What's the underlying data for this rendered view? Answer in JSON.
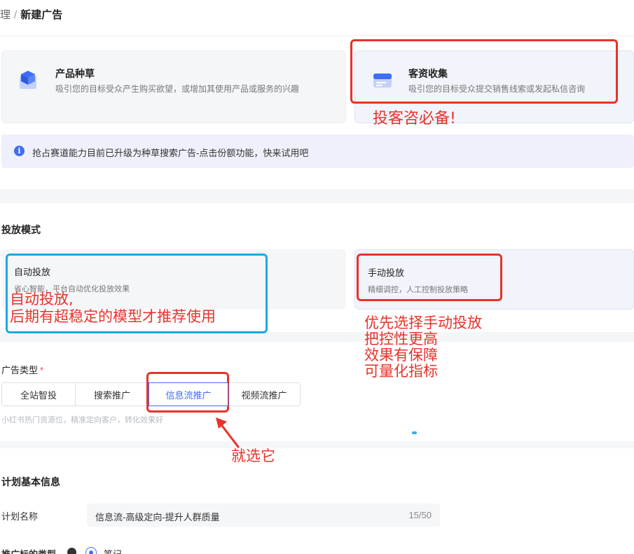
{
  "breadcrumb": {
    "prev": "理",
    "separator": "/",
    "current": "新建广告"
  },
  "goals": [
    {
      "title": "产品种草",
      "desc": "吸引您的目标受众产生购买欲望，或增加其使用产品或服务的兴趣",
      "icon": "cube-icon"
    },
    {
      "title": "客资收集",
      "desc": "吸引您的目标受众提交销售线索或发起私信咨询",
      "icon": "form-card-icon"
    }
  ],
  "notice": {
    "icon": "info-icon",
    "glyph": "i",
    "text": "抢占赛道能力目前已升级为种草搜索广告-点击份额功能，快来试用吧"
  },
  "mode_section": {
    "title": "投放模式",
    "cards": [
      {
        "title": "自动投放",
        "desc": "省心智能，平台自动优化投放效果"
      },
      {
        "title": "手动投放",
        "desc": "精细调控，人工控制投放策略"
      }
    ]
  },
  "ad_type": {
    "label": "广告类型",
    "required": "*",
    "options": [
      "全站智投",
      "搜索推广",
      "信息流推广",
      "视频流推广"
    ],
    "selected": "信息流推广",
    "hint": "小红书热门资源位，精准定向客户，转化效果好"
  },
  "plan_info": {
    "title": "计划基本信息",
    "name_label": "计划名称",
    "name_value": "信息流-高级定向-提升人群质量",
    "name_count": "15/50",
    "promo_label": "推广标的类型",
    "promo_option": "笔记"
  },
  "annotations": {
    "goal_note": "投客咨必备!",
    "auto_note_1": "自动投放,",
    "auto_note_2": "后期有超稳定的模型才推荐使用",
    "manual_note_1": "优先选择手动投放",
    "manual_note_2": "把控性更高",
    "manual_note_3": "效果有保障",
    "manual_note_4": "可量化指标",
    "select_note": "就选它"
  },
  "colors": {
    "accent": "#3f6df5",
    "annotation_red": "#e8322b",
    "annotation_blue": "#1ea7e6"
  }
}
